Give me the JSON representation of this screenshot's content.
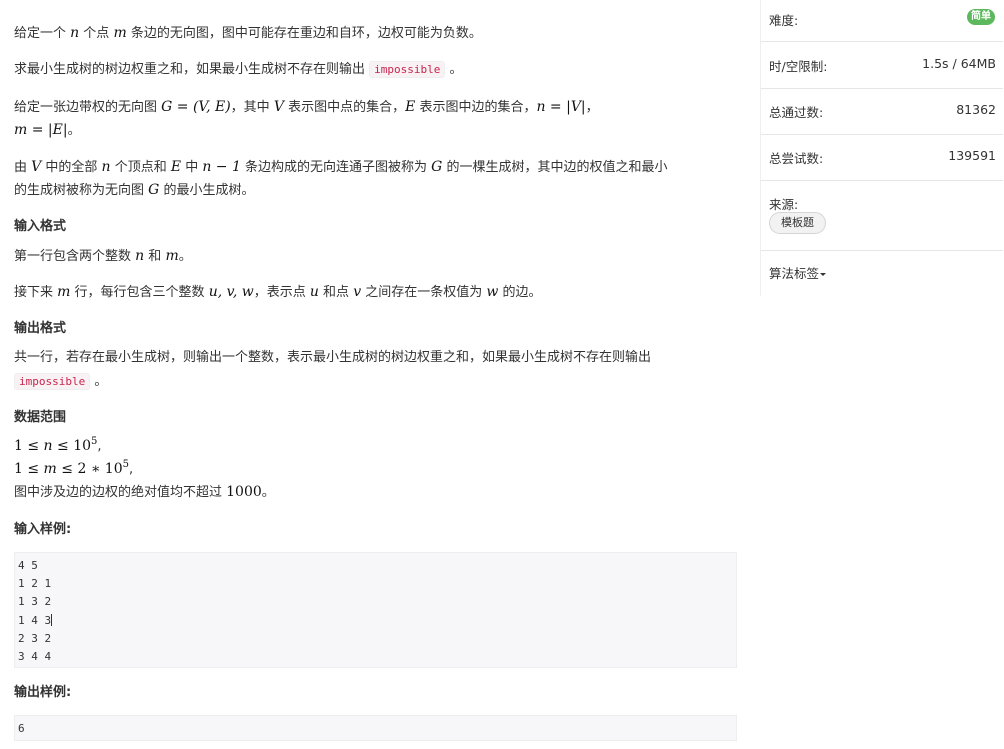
{
  "problem": {
    "p1": {
      "a": "给定一个 ",
      "n": "n",
      "b": " 个点 ",
      "m": "m",
      "c": " 条边的无向图，图中可能存在重边和自环，边权可能为负数。"
    },
    "p2": {
      "a": "求最小生成树的树边权重之和，如果最小生成树不存在则输出 ",
      "code": "impossible",
      "b": " 。"
    },
    "p3": {
      "a": "给定一张边带权的无向图 ",
      "formula1": "G = (V, E)",
      "b": "，其中 ",
      "V": "V",
      "c": " 表示图中点的集合，",
      "E": "E",
      "d": " 表示图中边的集合，",
      "formula2": "n = |V|",
      "e": "，",
      "formula3": "m = |E|",
      "f": "。"
    },
    "p4": {
      "a": "由 ",
      "V": "V",
      "b": " 中的全部 ",
      "n": "n",
      "c": " 个顶点和 ",
      "E": "E",
      "d": " 中 ",
      "formula": "n − 1",
      "e": " 条边构成的无向连通子图被称为 ",
      "G": "G",
      "f": " 的一棵生成树，其中边的权值之和最小",
      "g": "的生成树被称为无向图 ",
      "G2": "G",
      "h": " 的最小生成树。"
    },
    "input_title": "输入格式",
    "input1": {
      "a": "第一行包含两个整数 ",
      "n": "n",
      "b": " 和 ",
      "m": "m",
      "c": "。"
    },
    "input2": {
      "a": "接下来 ",
      "m": "m",
      "b": " 行，每行包含三个整数 ",
      "uvw": "u, v, w",
      "c": "，表示点 ",
      "u": "u",
      "d": " 和点 ",
      "v": "v",
      "e": " 之间存在一条权值为 ",
      "w": "w",
      "f": " 的边。"
    },
    "output_title": "输出格式",
    "output1": {
      "a": "共一行，若存在最小生成树，则输出一个整数，表示最小生成树的树边权重之和，如果最小生成树不存在则输出",
      "code": "impossible",
      "b": " 。"
    },
    "range_title": "数据范围",
    "range1": {
      "a": "1 ≤ ",
      "n": "n",
      "b": " ≤ 10",
      "exp": "5",
      "c": ","
    },
    "range2": {
      "a": "1 ≤ ",
      "m": "m",
      "b": " ≤ 2 ∗ 10",
      "exp": "5",
      "c": ","
    },
    "range3": {
      "a": "图中涉及边的边权的绝对值均不超过 ",
      "num": "1000",
      "b": "。"
    },
    "sample_in_title": "输入样例:",
    "sample_in": [
      "4 5",
      "1 2 1",
      "1 3 2",
      "1 4 3",
      "2 3 2",
      "3 4 4"
    ],
    "sample_out_title": "输出样例:",
    "sample_out": [
      "6"
    ]
  },
  "sidebar": {
    "difficulty_label": "难度:",
    "difficulty_badge": "简单",
    "limit_label": "时/空限制:",
    "limit_value": "1.5s / 64MB",
    "passed_label": "总通过数:",
    "passed_value": "81362",
    "tries_label": "总尝试数:",
    "tries_value": "139591",
    "source_label": "来源:",
    "source_tag": "模板题",
    "tags_label": "算法标签"
  },
  "colors": {
    "badge": "#5cb85c",
    "code_text": "#c7254e",
    "code_bg": "#f9f2f4",
    "pre_bg": "#f7f7f9"
  }
}
